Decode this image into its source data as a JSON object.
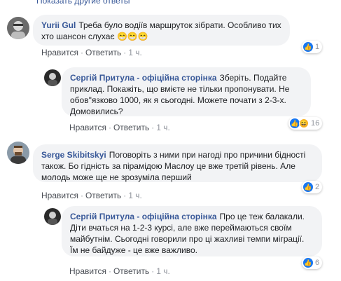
{
  "top_link": "Показать другие ответы",
  "actions": {
    "like": "Нравится",
    "reply": "Ответить",
    "dot": "·"
  },
  "comments": [
    {
      "author": "Yurii Gul",
      "text": "Треба було водіїв маршруток зібрати. Особливо тих хто шансон слухає",
      "emoji": "😁😁😁",
      "time": "1 ч.",
      "reactions": "1"
    },
    {
      "author": "Сергій Притула - офіційна сторінка",
      "text": "Зберіть. Подайте приклад. Покажіть, що вмієте не тільки пропонувати. Не обов\"язково 1000, як я сьогодні. Можете почати з 2-3-х. Домовились?",
      "time": "1 ч.",
      "reactions": "16"
    },
    {
      "author": "Serge Skibitskyi",
      "text": "Поговоріть з ними при нагоді про причини бідності також. Бо гідність за пірамідою Маслоу це вже третій рівень. Але молодь може ще не зрозуміла перший",
      "time": "1 ч.",
      "reactions": "2"
    },
    {
      "author": "Сергій Притула - офіційна сторінка",
      "text": "Про це теж балакали. Діти вчаться на 1-2-3 курсі, але вже переймаються своїм майбутнім. Сьогодні говорили про ці жахливі темпи міграції. Їм не байдуже - це вже важливо.",
      "time": "1 ч.",
      "reactions": "6"
    }
  ]
}
